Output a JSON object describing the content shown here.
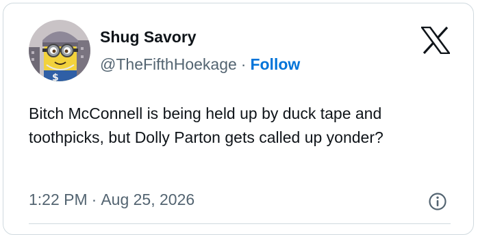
{
  "author": {
    "name": "Shug Savory",
    "handle": "@TheFifthHoekage",
    "separator": "·",
    "follow_label": "Follow"
  },
  "tweet": {
    "text": "Bitch McConnell is being held up by duck tape and toothpicks, but Dolly Parton gets called up yonder?",
    "time": "1:22 PM",
    "separator": "·",
    "date": "Aug 25, 2026"
  },
  "icons": {
    "platform_logo": "x-logo-icon",
    "info": "info-icon",
    "avatar": "minion-avatar"
  },
  "colors": {
    "follow": "#0074d9",
    "text": "#0f1419",
    "secondary": "#536471",
    "border": "#cfd9de"
  }
}
